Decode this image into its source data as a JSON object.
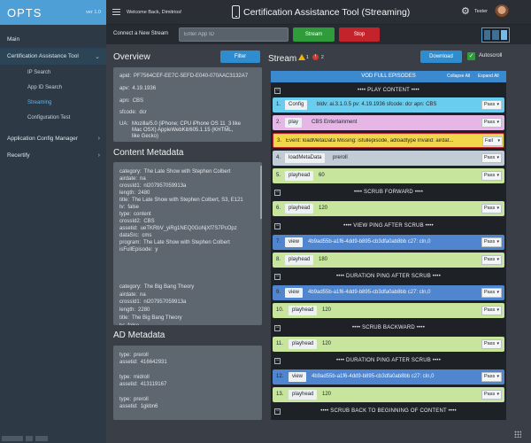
{
  "app": {
    "logo": "OPTS",
    "version": "ver 1.0"
  },
  "sidebar": {
    "main": "Main",
    "cat": {
      "label": "Certification Assistance Tool",
      "chevron": "chevron-down-icon"
    },
    "children": [
      "IP Search",
      "App ID Search",
      "Streaming",
      "Configuration Test"
    ],
    "active_child": "Streaming",
    "acm": {
      "label": "Application Config Manager",
      "chevron": "chevron-right-icon"
    },
    "recertify": {
      "label": "Recertify",
      "chevron": "chevron-right-icon"
    }
  },
  "header": {
    "welcome": "Welcome Back, Dimitrios!",
    "title": "Certification Assistance Tool (Streaming)",
    "user": "Tester"
  },
  "connect": {
    "label": "Connect a New Stream",
    "placeholder": "Enter App ID",
    "stream": "Stream",
    "stop": "Stop"
  },
  "overview": {
    "title": "Overview",
    "filter": "Filter",
    "apid": {
      "k": "apid:",
      "v": "PF7564CEF-EE7C-5EFD-E040-070AAC3132A7"
    },
    "apv": {
      "k": "apv:",
      "v": "4.19.1936"
    },
    "apn": {
      "k": "apn:",
      "v": "CBS"
    },
    "sfcode": {
      "k": "sfcode:",
      "v": "dcr"
    },
    "ua": {
      "k": "UA:",
      "lines": [
        "Mozilla/5.0 (iPhone; CPU iPhone OS 11_3 like",
        "Mac OSX) AppleWebKit/605.1.15 (KHTML,",
        "like Gecko)"
      ]
    }
  },
  "content_metadata": {
    "title": "Content Metadata",
    "block1": [
      {
        "k": "category:",
        "v": "The Late Show with Stephen Colbert"
      },
      {
        "k": "airdate:",
        "v": "na"
      },
      {
        "k": "crossId1:",
        "v": "nl207957059913a"
      },
      {
        "k": "length:",
        "v": "2480"
      },
      {
        "k": "title:",
        "v": "The Late Show with Stephen Colbert, S3, E121"
      },
      {
        "k": "tv:",
        "v": "false"
      },
      {
        "k": "type:",
        "v": "content"
      },
      {
        "k": "crossId2:",
        "v": "CBS"
      },
      {
        "k": "assetid:",
        "v": "ueTKRbV_yiRg1NEQ0GoNjXf7S7PcOpz"
      },
      {
        "k": "dataSrc:",
        "v": "cms"
      },
      {
        "k": "program:",
        "v": "The Late Show with Stephen Colbert"
      },
      {
        "k": "isFullEpisode:",
        "v": "y"
      }
    ],
    "block2": [
      {
        "k": "category:",
        "v": "The Big Bang Theory"
      },
      {
        "k": "airdate:",
        "v": "na"
      },
      {
        "k": "crossId1:",
        "v": "nl207957059913a"
      },
      {
        "k": "length:",
        "v": "2280"
      },
      {
        "k": "title:",
        "v": "The Big Bang Theory"
      },
      {
        "k": "tv:",
        "v": "false"
      }
    ]
  },
  "ad_metadata": {
    "title": "AD Metadata",
    "blocks": [
      [
        {
          "k": "type:",
          "v": "preroll"
        },
        {
          "k": "assetid:",
          "v": "416642931"
        }
      ],
      [
        {
          "k": "type:",
          "v": "midroll"
        },
        {
          "k": "assetid:",
          "v": "413119167"
        }
      ],
      [
        {
          "k": "type:",
          "v": "preroll"
        },
        {
          "k": "assetid:",
          "v": "1gkbn6"
        }
      ]
    ]
  },
  "stream": {
    "title": "Stream",
    "warnings": "1",
    "errors": "2",
    "download": "Download",
    "autoscroll": "Autoscroll",
    "vod_title": "VOD FULL EPISODES",
    "collapse_all": "Collapse All",
    "expand_all": "Expand All",
    "groups": [
      "•••• PLAY CONTENT ••••",
      "•••• SCRUB FORWARD ••••",
      "•••• VIEW PING AFTER SCRUB ••••",
      "•••• DURATION PING AFTER SCRUB ••••",
      "•••• SCRUB BACKWARD ••••",
      "•••• DURATION PING AFTER SCRUB ••••",
      "•••• SCRUB BACK TO BEGINNING OF CONTENT ••••"
    ],
    "rows": [
      {
        "n": "1.",
        "tag": "Config",
        "info": "bldv: ai.3.1.0.5    pv: 4.19.1936    sfcode: dcr    apn: CBS",
        "status": "Pass"
      },
      {
        "n": "2.",
        "tag": "play",
        "info": "CBS Entertainment",
        "status": "Pass"
      },
      {
        "n": "3.",
        "text": "Event: loadMetaData    Missing: isfullepisode, adloadtype    Invalid: airdat...",
        "status": "Fail"
      },
      {
        "n": "4.",
        "tag": "loadMetaData",
        "info": "preroll",
        "status": "Pass"
      },
      {
        "n": "5.",
        "tag": "playhead",
        "info": "60",
        "status": "Pass"
      },
      {
        "n": "6.",
        "tag": "playhead",
        "info": "120",
        "status": "Pass"
      },
      {
        "n": "7.",
        "tag": "view",
        "info": "4b9ad55b-a1f6-4dd9-b895-cb3dfa0ab8bb    c27: cln,0",
        "status": "Pass"
      },
      {
        "n": "8.",
        "tag": "playhead",
        "info": "180",
        "status": "Pass"
      },
      {
        "n": "9.",
        "tag": "view",
        "info": "4b9ad55b-a1f6-4dd9-b895-cb3dfa0ab8bb    c27: cln,0",
        "status": "Pass"
      },
      {
        "n": "10.",
        "tag": "playhead",
        "info": "120",
        "status": "Pass"
      },
      {
        "n": "11.",
        "tag": "playhead",
        "info": "120",
        "status": "Pass"
      },
      {
        "n": "12.",
        "tag": "view",
        "info": "4b9ad55b-a1f6-4dd9-b895-cb3dfa0ab8bb    c27: cln,0",
        "status": "Pass"
      },
      {
        "n": "13.",
        "tag": "playhead",
        "info": "120",
        "status": "Pass"
      }
    ]
  }
}
